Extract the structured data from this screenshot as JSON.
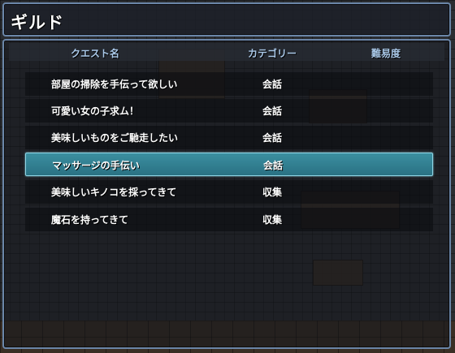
{
  "title": "ギルド",
  "columns": {
    "name": "クエスト名",
    "category": "カテゴリー",
    "difficulty": "難易度"
  },
  "quests": [
    {
      "name": "部屋の掃除を手伝って欲しい",
      "category": "会話",
      "difficulty": ""
    },
    {
      "name": "可愛い女の子求ム！",
      "category": "会話",
      "difficulty": ""
    },
    {
      "name": "美味しいものをご馳走したい",
      "category": "会話",
      "difficulty": ""
    },
    {
      "name": "マッサージの手伝い",
      "category": "会話",
      "difficulty": ""
    },
    {
      "name": "美味しいキノコを採ってきて",
      "category": "収集",
      "difficulty": ""
    },
    {
      "name": "魔石を持ってきて",
      "category": "収集",
      "difficulty": ""
    }
  ],
  "selected_index": 3,
  "colors": {
    "window_border": "#6b86a8",
    "header_text": "#a9c8e8",
    "selection": "#2f8395",
    "text": "#ffffff"
  }
}
